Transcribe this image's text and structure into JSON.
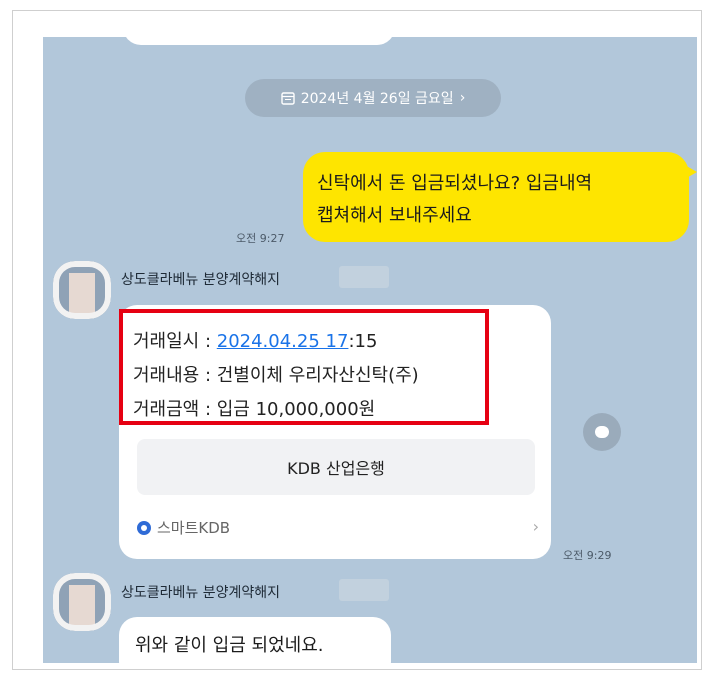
{
  "date_pill": {
    "label": "2024년 4월 26일 금요일"
  },
  "messages": {
    "mine": {
      "text_line1": "신탁에서 돈 입금되셨나요?  입금내역",
      "text_line2": "캡쳐해서 보내주세요",
      "time": "오전 9:27"
    },
    "receipt": {
      "sender": "상도클라베뉴 분양계약해지",
      "date_label": "거래일시 : ",
      "date_value": "2024.04.25 17",
      "date_suffix": ":15",
      "content_line": "거래내용 : 건별이체 우리자산신탁(주)",
      "amount_line": "거래금액 : 입금 10,000,000원",
      "bank_button": "KDB 산업은행",
      "footer_label": "스마트KDB",
      "time": "오전 9:29"
    },
    "last": {
      "sender": "상도클라베뉴 분양계약해지",
      "text": "위와 같이 입금 되었네요."
    }
  },
  "colors": {
    "chat_bg": "#b2c7da",
    "my_bubble": "#fee500",
    "highlight_box": "#e60012",
    "link": "#1a73e8"
  }
}
